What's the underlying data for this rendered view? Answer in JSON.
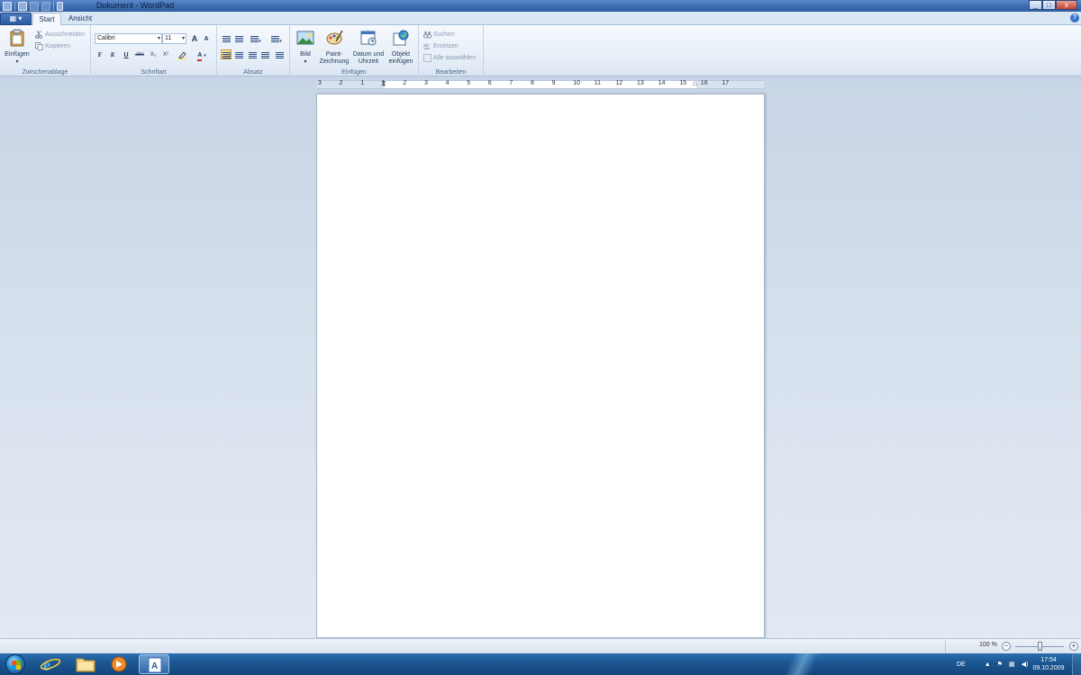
{
  "window": {
    "title": "Dokument - WordPad",
    "buttons": [
      "minimize",
      "maximize",
      "close"
    ]
  },
  "ribbon_tabs": [
    {
      "label": "Start",
      "active": true
    },
    {
      "label": "Ansicht",
      "active": false
    }
  ],
  "ribbon": {
    "clipboard": {
      "paste_label": "Einfügen",
      "cut_label": "Ausschneiden",
      "copy_label": "Kopieren",
      "group_label": "Zwischenablage"
    },
    "font": {
      "font_name": "Calibri",
      "font_size": "11",
      "bold": "F",
      "italic": "K",
      "underline": "U",
      "strikethrough": "abc",
      "subscript": "X₂",
      "superscript": "X²",
      "grow": "A",
      "shrink": "A",
      "group_label": "Schriftart"
    },
    "paragraph": {
      "group_label": "Absatz"
    },
    "insert": {
      "picture_label": "Bild",
      "paint_label_1": "Paint-",
      "paint_label_2": "Zeichnung",
      "datetime_label_1": "Datum und",
      "datetime_label_2": "Uhrzeit",
      "object_label_1": "Objekt",
      "object_label_2": "einfügen",
      "group_label": "Einfügen"
    },
    "editing": {
      "find_label": "Suchen",
      "replace_label": "Ersetzen",
      "select_all_label": "Alle auswählen",
      "group_label": "Bearbeiten"
    }
  },
  "ruler": {
    "labels": [
      "3",
      "2",
      "1",
      "1",
      "2",
      "3",
      "4",
      "5",
      "6",
      "7",
      "8",
      "9",
      "10",
      "11",
      "12",
      "13",
      "14",
      "15",
      "16",
      "17"
    ]
  },
  "status_bar": {
    "zoom_label": "100 %",
    "zoom_minus": "−",
    "zoom_plus": "+"
  },
  "taskbar": {
    "language": "DE",
    "time": "17:54",
    "date": "09.10.2009"
  },
  "colors": {
    "ribbon_bg": "#e5edf7",
    "title_bar": "#3f6fb3",
    "taskbar": "#1b5590",
    "selected_button": "#f6c45a"
  }
}
